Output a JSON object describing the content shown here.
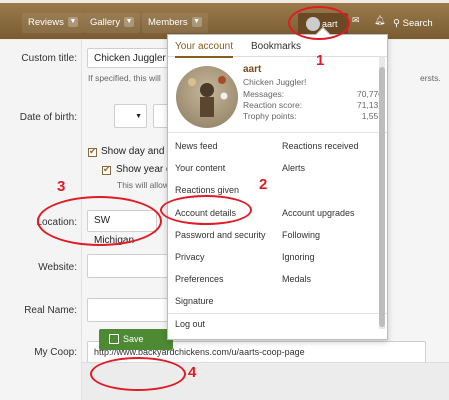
{
  "nav": {
    "items": [
      "Reviews",
      "Gallery",
      "Members"
    ],
    "username": "aart",
    "search": "Search"
  },
  "form": {
    "custom_title_label": "Custom title:",
    "custom_title_value": "Chicken Juggler",
    "custom_title_hint": "If specified, this will",
    "custom_title_hint_tail": "ersts.",
    "dob_label": "Date of birth:",
    "show_day_label": "Show day and r",
    "show_year_label": "Show year o",
    "show_year_hint": "This will allow",
    "location_label": "Location:",
    "location_value": "SW Michigan",
    "website_label": "Website:",
    "realname_label": "Real Name:",
    "mycoop_label": "My Coop:",
    "mycoop_value": "http://www.backyardchickens.com/u/aarts-coop-page",
    "save_label": "Save"
  },
  "menu": {
    "tabs": [
      "Your account",
      "Bookmarks"
    ],
    "user": {
      "name": "aart",
      "title": "Chicken Juggler!",
      "stats": [
        {
          "label": "Messages:",
          "value": "70,770"
        },
        {
          "label": "Reaction score:",
          "value": "71,131"
        },
        {
          "label": "Trophy points:",
          "value": "1,557"
        }
      ]
    },
    "left_items": [
      "News feed",
      "Your content",
      "Reactions given",
      "Account details",
      "Password and security",
      "Privacy",
      "Preferences",
      "Signature",
      "Log out"
    ],
    "right_items": [
      "Reactions received",
      "Alerts",
      "Account upgrades",
      "Following",
      "Ignoring",
      "Medals"
    ]
  },
  "annotations": [
    "1",
    "2",
    "3",
    "4"
  ],
  "colors": {
    "annotation": "#e01b24",
    "brand": "#8a5a20",
    "save": "#4e8a34"
  }
}
